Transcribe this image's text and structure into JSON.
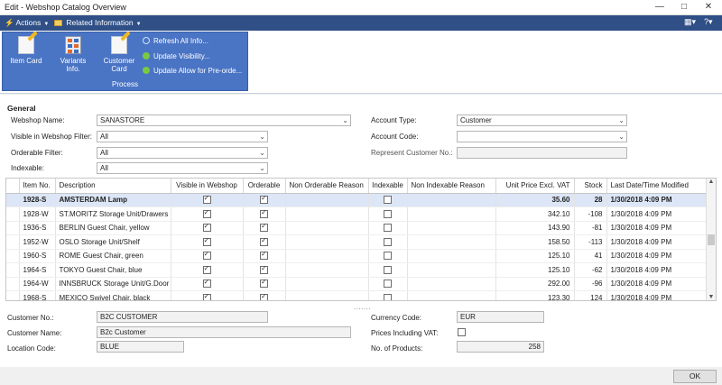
{
  "window": {
    "title": "Edit - Webshop Catalog Overview"
  },
  "menubar": {
    "actions": "Actions",
    "related": "Related Information"
  },
  "ribbon": {
    "item_card": "Item Card",
    "variants": "Variants Info.",
    "customer_card": "Customer Card",
    "refresh": "Refresh All Info...",
    "update_visibility": "Update Visibility...",
    "update_allow": "Update Allow for Pre-orde...",
    "group_label": "Process"
  },
  "general": {
    "section_title": "General",
    "webshop_name_label": "Webshop Name:",
    "webshop_name": "SANASTORE",
    "visible_filter_label": "Visible in Webshop Filter:",
    "visible_filter": "All",
    "orderable_filter_label": "Orderable Filter:",
    "orderable_filter": "All",
    "indexable_label": "Indexable:",
    "indexable": "All",
    "account_type_label": "Account Type:",
    "account_type": "Customer",
    "account_code_label": "Account Code:",
    "account_code": "",
    "represent_label": "Represent Customer No.:",
    "represent": ""
  },
  "grid": {
    "columns": [
      "Item No.",
      "Description",
      "Visible in Webshop",
      "Orderable",
      "Non Orderable Reason",
      "Indexable",
      "Non Indexable Reason",
      "Unit Price Excl. VAT",
      "Stock",
      "Last Date/Time Modified"
    ],
    "rows": [
      {
        "item_no": "1928-S",
        "description": "AMSTERDAM Lamp",
        "visible": true,
        "orderable": true,
        "non_orderable_reason": "",
        "indexable": false,
        "non_indexable_reason": "",
        "price": "35.60",
        "stock": "28",
        "modified": "1/30/2018 4:09 PM",
        "selected": true
      },
      {
        "item_no": "1928-W",
        "description": "ST.MORITZ Storage Unit/Drawers",
        "visible": true,
        "orderable": true,
        "non_orderable_reason": "",
        "indexable": false,
        "non_indexable_reason": "",
        "price": "342.10",
        "stock": "-108",
        "modified": "1/30/2018 4:09 PM",
        "selected": false
      },
      {
        "item_no": "1936-S",
        "description": "BERLIN Guest Chair, yellow",
        "visible": true,
        "orderable": true,
        "non_orderable_reason": "",
        "indexable": false,
        "non_indexable_reason": "",
        "price": "143.90",
        "stock": "-81",
        "modified": "1/30/2018 4:09 PM",
        "selected": false
      },
      {
        "item_no": "1952-W",
        "description": "OSLO Storage Unit/Shelf",
        "visible": true,
        "orderable": true,
        "non_orderable_reason": "",
        "indexable": false,
        "non_indexable_reason": "",
        "price": "158.50",
        "stock": "-113",
        "modified": "1/30/2018 4:09 PM",
        "selected": false
      },
      {
        "item_no": "1960-S",
        "description": "ROME Guest Chair, green",
        "visible": true,
        "orderable": true,
        "non_orderable_reason": "",
        "indexable": false,
        "non_indexable_reason": "",
        "price": "125.10",
        "stock": "41",
        "modified": "1/30/2018 4:09 PM",
        "selected": false
      },
      {
        "item_no": "1964-S",
        "description": "TOKYO Guest Chair, blue",
        "visible": true,
        "orderable": true,
        "non_orderable_reason": "",
        "indexable": false,
        "non_indexable_reason": "",
        "price": "125.10",
        "stock": "-62",
        "modified": "1/30/2018 4:09 PM",
        "selected": false
      },
      {
        "item_no": "1964-W",
        "description": "INNSBRUCK Storage Unit/G.Door",
        "visible": true,
        "orderable": true,
        "non_orderable_reason": "",
        "indexable": false,
        "non_indexable_reason": "",
        "price": "292.00",
        "stock": "-96",
        "modified": "1/30/2018 4:09 PM",
        "selected": false
      },
      {
        "item_no": "1968-S",
        "description": "MEXICO Swivel Chair, black",
        "visible": true,
        "orderable": true,
        "non_orderable_reason": "",
        "indexable": false,
        "non_indexable_reason": "",
        "price": "123.30",
        "stock": "124",
        "modified": "1/30/2018 4:09 PM",
        "selected": false
      }
    ]
  },
  "details": {
    "customer_no_label": "Customer No.:",
    "customer_no": "B2C CUSTOMER",
    "customer_name_label": "Customer Name:",
    "customer_name": "B2c Customer",
    "location_label": "Location Code:",
    "location": "BLUE",
    "currency_label": "Currency Code:",
    "currency": "EUR",
    "prices_vat_label": "Prices Including VAT:",
    "prices_vat": false,
    "num_products_label": "No. of Products:",
    "num_products": "258"
  },
  "footer": {
    "ok": "OK"
  }
}
